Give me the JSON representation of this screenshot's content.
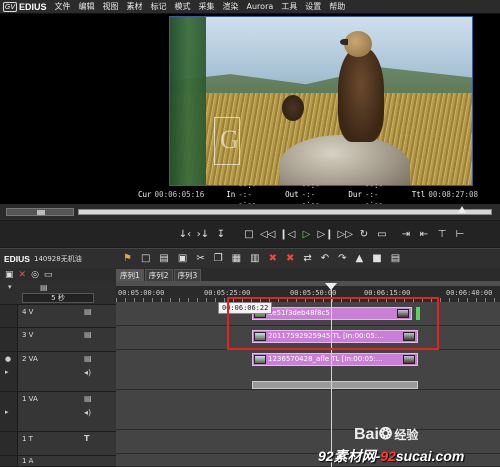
{
  "menubar": {
    "logo_text": "GV",
    "app_title": "EDIUS",
    "items": [
      "文件",
      "编辑",
      "视图",
      "素材",
      "标记",
      "模式",
      "采集",
      "渲染",
      "Aurora",
      "工具",
      "设置",
      "帮助"
    ]
  },
  "monitor": {
    "overlay_letter": "G",
    "timecode": {
      "cur_label": "Cur",
      "cur_value": "00:06:05:16",
      "in_label": "In",
      "in_value": "--:--:--:--",
      "out_label": "Out",
      "out_value": "--:--:--:--",
      "dur_label": "Dur",
      "dur_value": "--:--:--:--",
      "ttl_label": "Ttl",
      "ttl_value": "00:08:27:08"
    },
    "scrub_position_fraction": 0.93
  },
  "transport": {
    "buttons": [
      "mark-in",
      "mark-out",
      "set-in",
      "stop",
      "rewind",
      "step-back",
      "play",
      "step-forward",
      "fast-forward",
      "loop",
      "overwrite",
      "insert"
    ]
  },
  "timeline": {
    "app_title": "EDIUS",
    "project_name": "140928无机油",
    "tabs": [
      "序列1",
      "序列2",
      "序列3"
    ],
    "active_tab": 0,
    "scale_label": "5 秒",
    "ruler_labels": [
      "00:05:00:00",
      "00:05:25:00",
      "00:05:50:00",
      "00:06:15:00",
      "00:06:40:00"
    ],
    "tooltip": "00:06:06:22",
    "tracks": [
      {
        "name": "4 V",
        "type": "video"
      },
      {
        "name": "3 V",
        "type": "video"
      },
      {
        "name": "2 VA",
        "type": "video-audio"
      },
      {
        "name": "1 VA",
        "type": "video-audio"
      },
      {
        "name": "1 T",
        "type": "title"
      },
      {
        "name": "1 A",
        "type": "audio"
      }
    ],
    "clips": {
      "track4": "ae51f3deb48f8c5",
      "track3": "20117592925945   TL [In:00:05:...",
      "track2": "1236570428_afle   TL [In:00:05:..."
    }
  },
  "watermark": {
    "baidu": "Bai",
    "baidu_cn": "经验",
    "site_prefix": "92素材网-",
    "site_red": "92",
    "site_suffix": "sucai.com"
  },
  "colors": {
    "clip_fill": "#c97fd6",
    "highlight_box": "#e32222",
    "play_button": "#6fdc5a",
    "playhead": "#a9e2ff"
  }
}
